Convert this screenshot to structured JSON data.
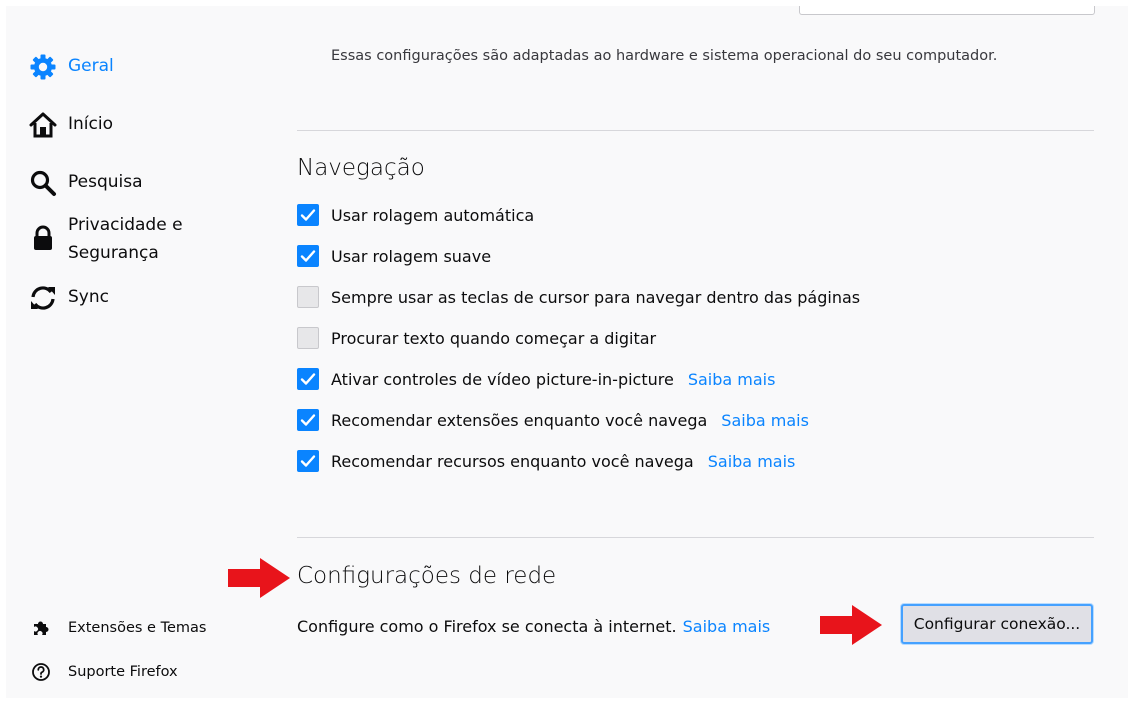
{
  "sidebar": {
    "items": [
      {
        "label": "Geral",
        "icon": "gear-icon",
        "active": true
      },
      {
        "label": "Início",
        "icon": "home-icon"
      },
      {
        "label": "Pesquisa",
        "icon": "search-icon"
      },
      {
        "label": "Privacidade e Segurança",
        "icon": "lock-icon"
      },
      {
        "label": "Sync",
        "icon": "sync-icon"
      }
    ],
    "footer": [
      {
        "label": "Extensões e Temas",
        "icon": "puzzle-icon"
      },
      {
        "label": "Suporte Firefox",
        "icon": "help-icon"
      }
    ]
  },
  "performance": {
    "description": "Essas configurações são adaptadas ao hardware e sistema operacional do seu computador."
  },
  "browsing": {
    "title": "Navegação",
    "options": [
      {
        "label": "Usar rolagem automática",
        "checked": true
      },
      {
        "label": "Usar rolagem suave",
        "checked": true
      },
      {
        "label": "Sempre usar as teclas de cursor para navegar dentro das páginas",
        "checked": false
      },
      {
        "label": "Procurar texto quando começar a digitar",
        "checked": false
      },
      {
        "label": "Ativar controles de vídeo picture-in-picture",
        "checked": true,
        "link": "Saiba mais"
      },
      {
        "label": "Recomendar extensões enquanto você navega",
        "checked": true,
        "link": "Saiba mais"
      },
      {
        "label": "Recomendar recursos enquanto você navega",
        "checked": true,
        "link": "Saiba mais"
      }
    ]
  },
  "network": {
    "title": "Configurações de rede",
    "description": "Configure como o Firefox se conecta à internet.",
    "link": "Saiba mais",
    "button": "Configurar conexão..."
  },
  "colors": {
    "accent": "#0a84ff",
    "arrow": "#e8141b"
  }
}
